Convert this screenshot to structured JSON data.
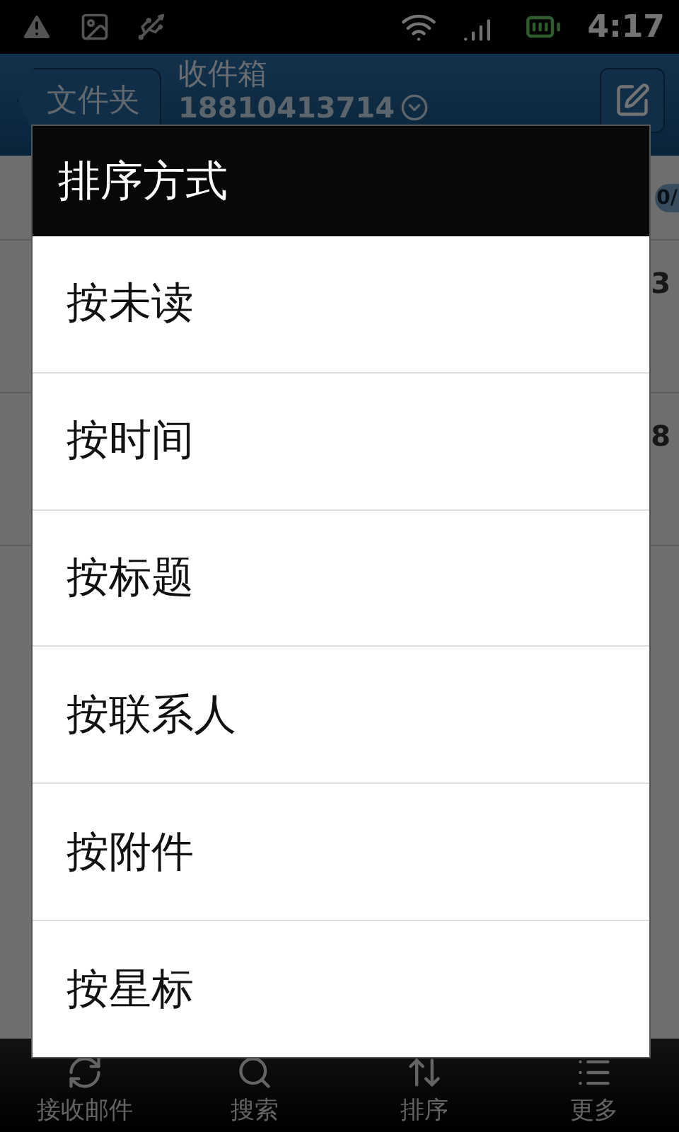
{
  "status_bar": {
    "time": "4:17"
  },
  "header": {
    "back_button": "文件夹",
    "title": "收件箱",
    "account": "18810413714"
  },
  "list": {
    "badge": "0/",
    "rows": [
      {
        "time": "3"
      },
      {
        "time": "8"
      }
    ]
  },
  "dialog": {
    "title": "排序方式",
    "options": [
      {
        "label": "按未读"
      },
      {
        "label": "按时间"
      },
      {
        "label": "按标题"
      },
      {
        "label": "按联系人"
      },
      {
        "label": "按附件"
      },
      {
        "label": "按星标"
      }
    ]
  },
  "bottom_bar": [
    {
      "kind": "refresh",
      "label": "接收邮件"
    },
    {
      "kind": "search",
      "label": "搜索"
    },
    {
      "kind": "sort",
      "label": "排序"
    },
    {
      "kind": "more",
      "label": "更多"
    }
  ]
}
